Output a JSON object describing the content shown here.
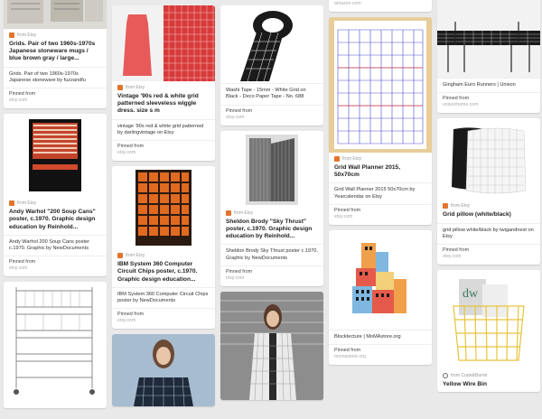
{
  "pins": {
    "mugs": {
      "source": "from Etsy",
      "title": "Grids. Pair of two 1960s-1970s Japanese stoneware mugs / blue brown gray / large...",
      "description": "Grids. Pair of two 1960s-1970s Japanese stoneware by fuzzandfu",
      "pinned_label": "Pinned from",
      "pinned_site": "etsy.com"
    },
    "warhol": {
      "source": "from Etsy",
      "title": "Andy Warhol \"200 Soup Cans\" poster, c.1970. Graphic design education by Reinhold...",
      "description": "Andy Warhol 200 Soup Cans poster c.1970. Graphic by NewDocuments",
      "pinned_label": "Pinned from",
      "pinned_site": "etsy.com"
    },
    "dress": {
      "source": "from Etsy",
      "title": "Vintage '90s red & white grid patterned sleeveless wiggle dress. size s m",
      "description": "vintage '90s red & white grid patterned by darlingvintage on Etsy",
      "pinned_label": "Pinned from",
      "pinned_site": "etsy.com"
    },
    "ibm": {
      "source": "from Etsy",
      "title": "IBM System 360 Computer Circuit Chips poster, c.1970. Graphic design education...",
      "description": "IBM System 360 Computer Circuit Chips poster by NewDocuments",
      "pinned_label": "Pinned from",
      "pinned_site": "etsy.com"
    },
    "tape": {
      "description": "Washi Tape - 15mm - White Grid on Black - Deco Paper Tape - No. 688",
      "pinned_label": "Pinned from",
      "pinned_site": "etsy.com"
    },
    "brody": {
      "source": "from Etsy",
      "title": "Sheldon Brody \"Sky Thrust\" poster, c.1970. Graphic design education by Reinhold...",
      "description": "Sheldon Brody Sky Thrust poster c.1970. Graphic by NewDocuments",
      "pinned_label": "Pinned from",
      "pinned_site": "etsy.com"
    },
    "planner": {
      "top_site": "amazon.com",
      "source": "from Etsy",
      "title": "Grid Wall Planner 2015, 50x70cm",
      "description": "Grid Wall Planner 2015 50x70cm by Yearcalendar on Etsy",
      "pinned_label": "Pinned from",
      "pinned_site": "etsy.com"
    },
    "blocktecture": {
      "description": "Blocktecture | MoMAstore.org",
      "pinned_label": "Pinned from",
      "pinned_site": "momastore.org"
    },
    "runners": {
      "description": "Gingham Euro Runners | Unison",
      "pinned_label": "Pinned from",
      "pinned_site": "unisonhome.com"
    },
    "pillow": {
      "source": "from Etsy",
      "title": "Grid pillow (white/black)",
      "description": "grid pillow white/black by twigandnest on Etsy",
      "pinned_label": "Pinned from",
      "pinned_site": "etsy.com"
    },
    "wirebin": {
      "source": "from Crate&Barrel",
      "title": "Yellow Wire Bin"
    }
  }
}
